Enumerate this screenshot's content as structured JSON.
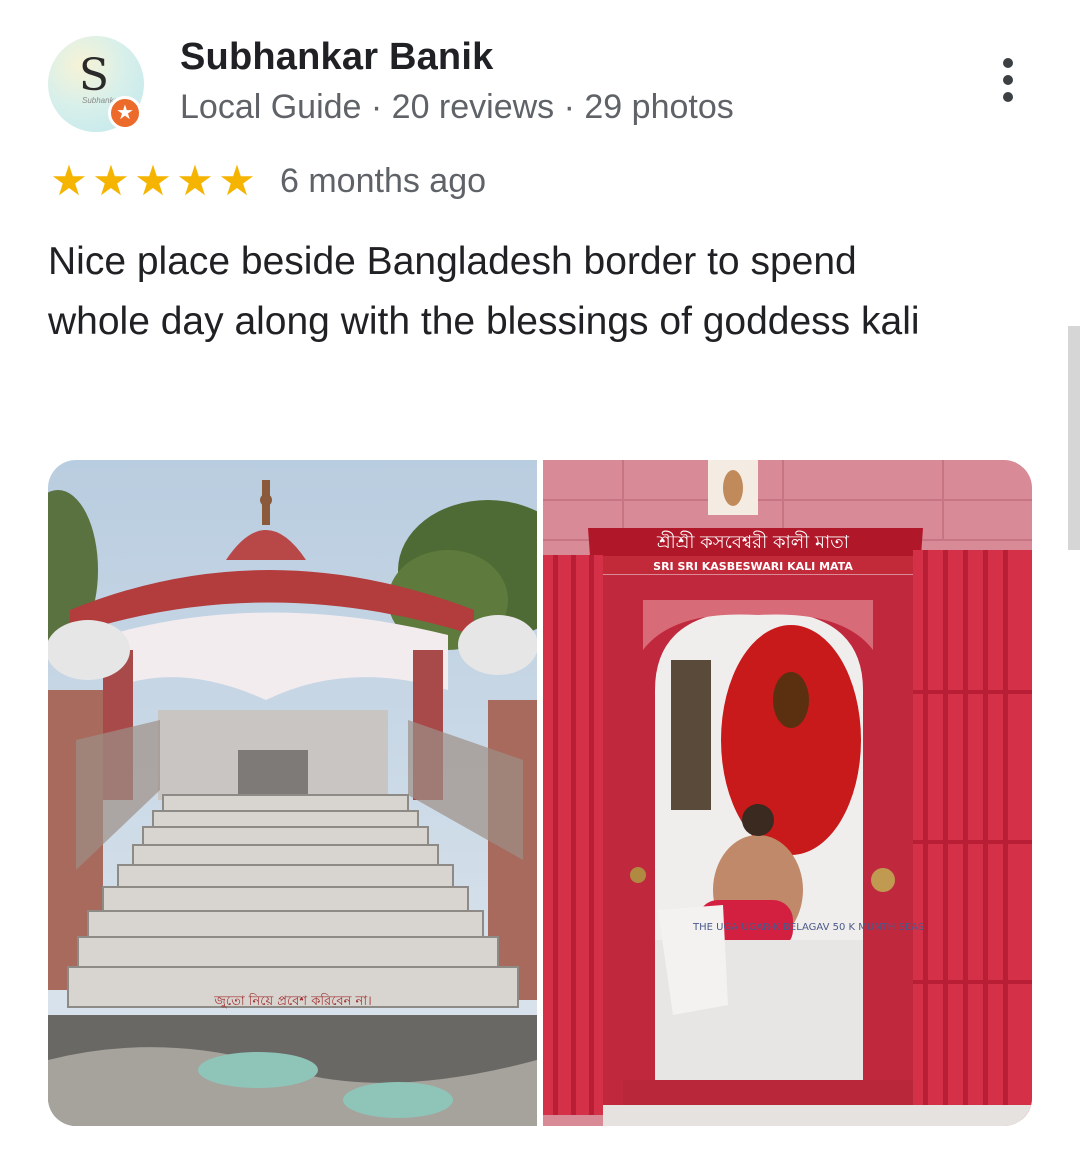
{
  "reviewer": {
    "avatar_letter": "S",
    "avatar_subtext": "Subhankar",
    "name": "Subhankar Banik",
    "meta": "Local Guide · 20 reviews · 29 photos"
  },
  "review": {
    "rating": 5,
    "rating_max": 5,
    "time": "6 months ago",
    "text": "Nice place beside Bangladesh border to spend whole day along with the blessings of goddess kali"
  },
  "photos": {
    "left": {
      "floor_text": "জুতো নিয়ে প্রবেশ করিবেন না।"
    },
    "right": {
      "sign_bengali": "শ্রীশ্রী কসবেশ্বরী কালী মাতা",
      "sign_english": "SRI SRI KASBESWARI KALI MATA",
      "bag_text": "THE UGA UGAR-K BELAGAV 50 K MUNTH SEAS"
    }
  },
  "icons": {
    "badge": "local-guide-star-icon",
    "menu": "more-vertical-icon",
    "star": "star-icon"
  },
  "colors": {
    "star": "#f5b400",
    "badge": "#ec6a2a",
    "secondary_text": "#5f6368"
  }
}
